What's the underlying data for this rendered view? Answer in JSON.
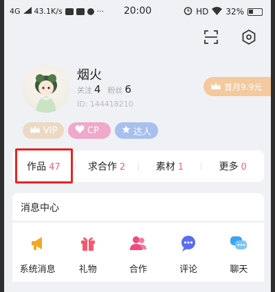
{
  "status_bar": {
    "network": "4G",
    "speed": "43.1K/s",
    "time": "20:00",
    "hd": "HD",
    "battery": "32%"
  },
  "profile": {
    "name": "烟火",
    "follow_label": "关注",
    "follow_count": "4",
    "fans_label": "粉丝",
    "fans_count": "6",
    "id": "ID: 144418210",
    "promo": "首月9.9元"
  },
  "badges": [
    {
      "label": "VIP",
      "color": "#ecd9c4"
    },
    {
      "label": "CP",
      "color": "#f0a8cb"
    },
    {
      "label": "达人",
      "color": "#a8c0ee"
    }
  ],
  "works": [
    {
      "label": "作品",
      "count": "47"
    },
    {
      "label": "求合作",
      "count": "2"
    },
    {
      "label": "素材",
      "count": "1"
    },
    {
      "label": "更多",
      "count": "0"
    }
  ],
  "messages": {
    "title": "消息中心",
    "items": [
      {
        "label": "系统消息",
        "icon": "megaphone-icon",
        "color": "#f5a623"
      },
      {
        "label": "礼物",
        "icon": "gift-icon",
        "color": "#f25a6e"
      },
      {
        "label": "合作",
        "icon": "people-icon",
        "color": "#f04a7c"
      },
      {
        "label": "评论",
        "icon": "comment-icon",
        "color": "#5a6df0"
      },
      {
        "label": "聊天",
        "icon": "chat-icon",
        "color": "#3aa6f2"
      }
    ]
  },
  "colors": {
    "accent_count": "#ee5f7e",
    "highlight_box": "#e92020",
    "promo": "#f3c99d"
  }
}
